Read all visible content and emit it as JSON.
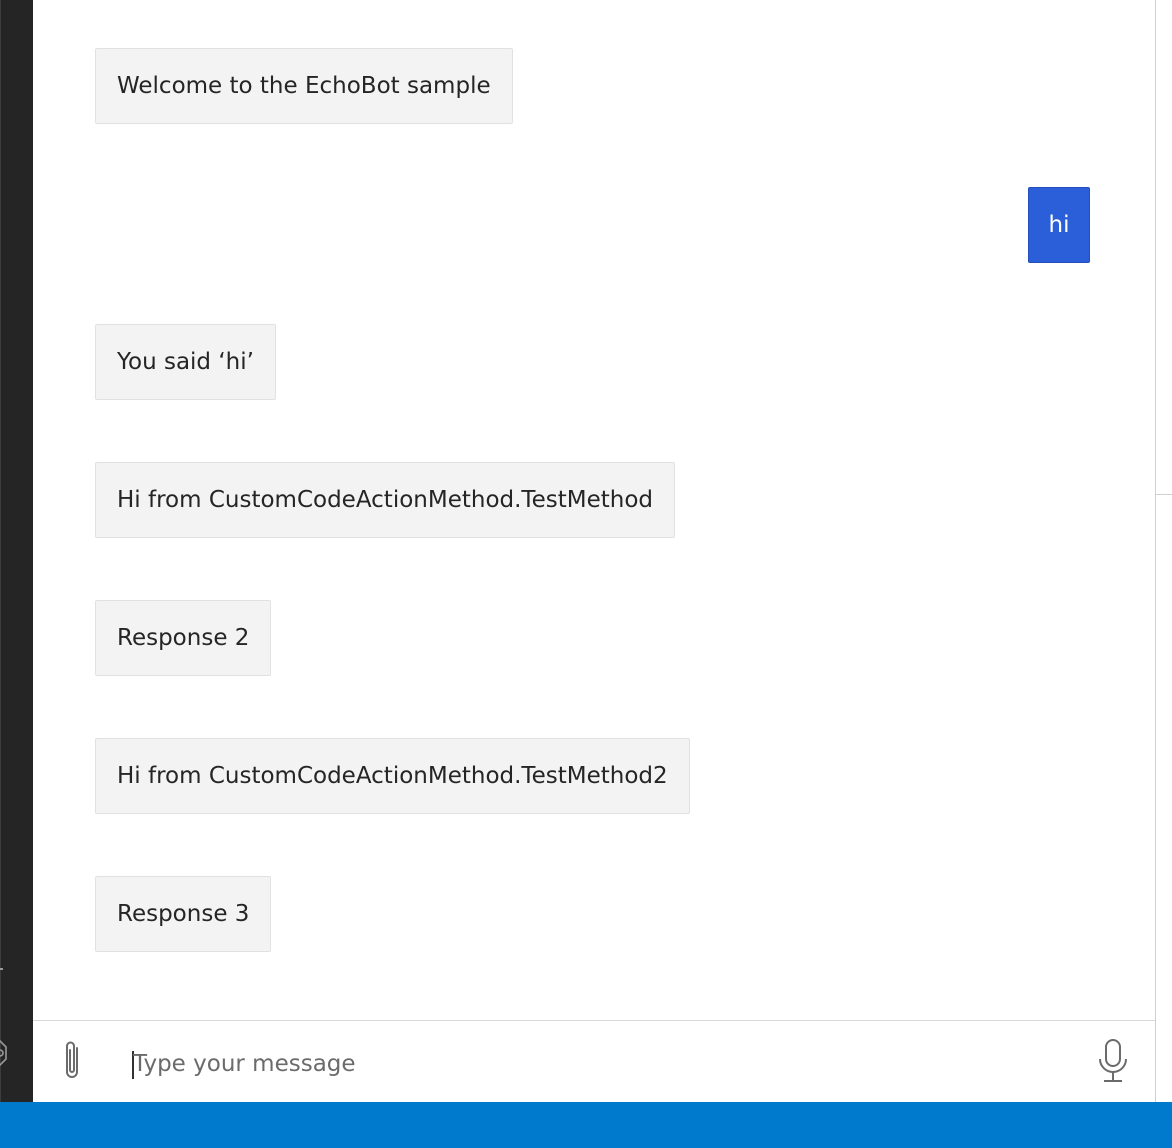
{
  "colors": {
    "status_bar": "#007acc",
    "user_bubble": "#2b5fd9",
    "bot_bubble": "#f3f3f3",
    "sidebar": "#252526"
  },
  "messages": [
    {
      "from": "bot",
      "text": "Welcome to the EchoBot sample"
    },
    {
      "from": "user",
      "text": "hi"
    },
    {
      "from": "bot",
      "text": "You said ‘hi’"
    },
    {
      "from": "bot",
      "text": "Hi from CustomCodeActionMethod.TestMethod"
    },
    {
      "from": "bot",
      "text": "Response 2"
    },
    {
      "from": "bot",
      "text": "Hi from CustomCodeActionMethod.TestMethod2"
    },
    {
      "from": "bot",
      "text": "Response 3"
    }
  ],
  "composer": {
    "placeholder": "Type your message",
    "value": "",
    "attach_icon": "paperclip-icon",
    "mic_icon": "microphone-icon"
  }
}
